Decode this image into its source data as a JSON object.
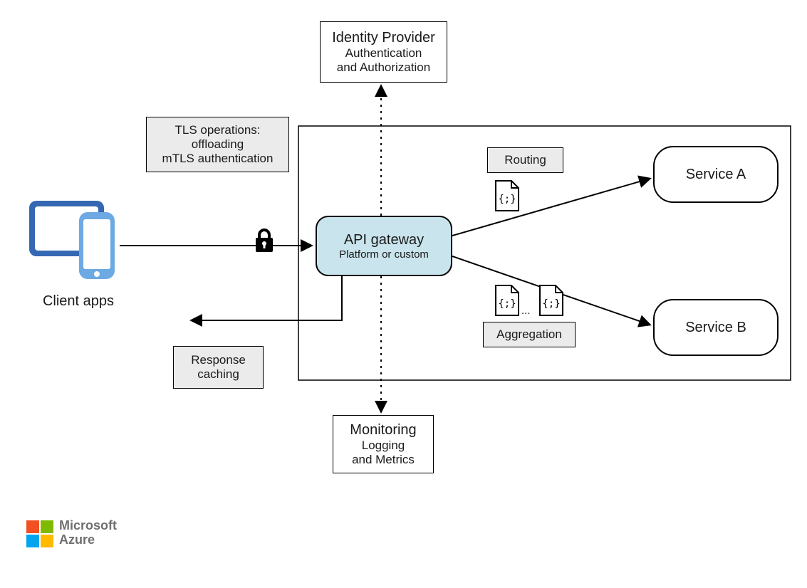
{
  "identity_provider": {
    "title": "Identity Provider",
    "line1": "Authentication",
    "line2": "and Authorization"
  },
  "tls_box": {
    "title": "TLS operations:",
    "line1": "offloading",
    "line2": "mTLS authentication"
  },
  "gateway": {
    "title": "API gateway",
    "subtitle": "Platform or custom"
  },
  "routing_label": "Routing",
  "aggregation_label": "Aggregation",
  "aggregation_ellipsis": "...",
  "service_a": "Service A",
  "service_b": "Service B",
  "client_apps_label": "Client apps",
  "response_caching": {
    "line1": "Response",
    "line2": "caching"
  },
  "monitoring": {
    "title": "Monitoring",
    "line1": "Logging",
    "line2": "and Metrics"
  },
  "footer": {
    "brand1": "Microsoft",
    "brand2": "Azure"
  },
  "colors": {
    "gateway_fill": "#c9e4ec",
    "device_blue_dark": "#3468b3",
    "device_blue_light": "#7fb4ea",
    "label_grey": "#ebebeb"
  },
  "icons": {
    "lock": "lock-icon",
    "code_doc": "code-doc-icon",
    "devices": "client-devices-icon"
  }
}
